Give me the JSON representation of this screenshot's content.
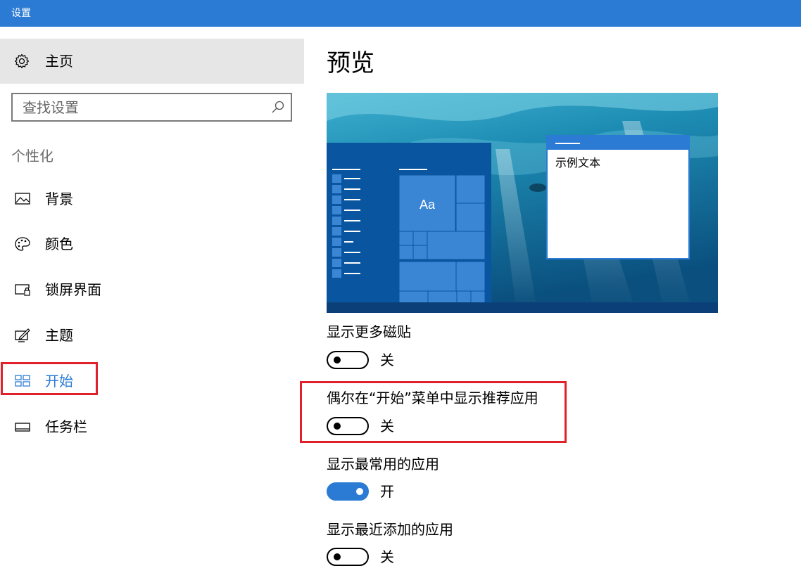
{
  "titlebar": {
    "title": "设置"
  },
  "sidebar": {
    "home_label": "主页",
    "search_placeholder": "查找设置",
    "section": "个性化",
    "items": [
      {
        "label": "背景",
        "icon": "image-icon"
      },
      {
        "label": "颜色",
        "icon": "palette-icon"
      },
      {
        "label": "锁屏界面",
        "icon": "lock-screen-icon"
      },
      {
        "label": "主题",
        "icon": "theme-icon"
      },
      {
        "label": "开始",
        "icon": "start-icon",
        "active": true
      },
      {
        "label": "任务栏",
        "icon": "taskbar-icon"
      }
    ]
  },
  "main": {
    "title": "预览",
    "preview": {
      "tile_text": "Aa",
      "window_text": "示例文本"
    },
    "settings": [
      {
        "label": "显示更多磁贴",
        "state": "关",
        "on": false
      },
      {
        "label": "偶尔在“开始”菜单中显示推荐应用",
        "state": "关",
        "on": false
      },
      {
        "label": "显示最常用的应用",
        "state": "开",
        "on": true
      },
      {
        "label": "显示最近添加的应用",
        "state": "关",
        "on": false
      }
    ]
  },
  "colors": {
    "accent": "#2b7bd4",
    "highlight": "#e0202a"
  }
}
